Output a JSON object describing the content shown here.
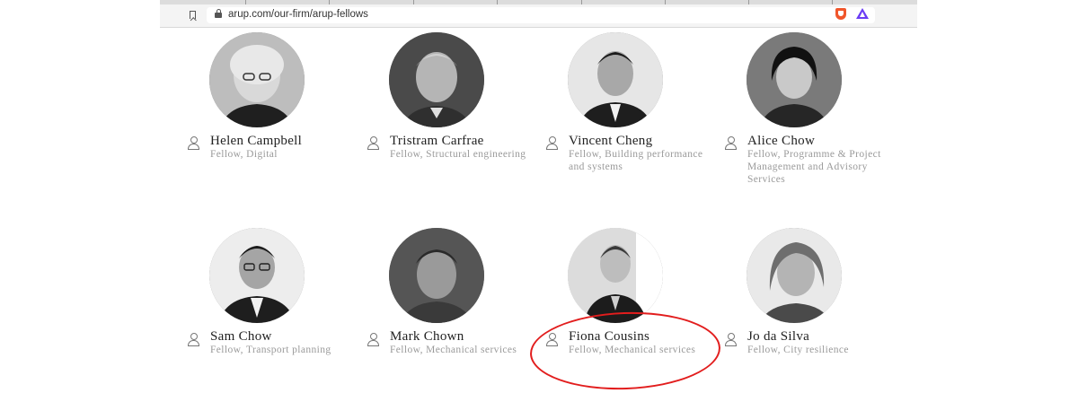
{
  "browser": {
    "url": "arup.com/our-firm/arup-fellows"
  },
  "fellows": [
    {
      "name": "Helen Campbell",
      "role": "Fellow, Digital"
    },
    {
      "name": "Tristram Carfrae",
      "role": "Fellow, Structural engineering"
    },
    {
      "name": "Vincent Cheng",
      "role": "Fellow, Building performance and systems"
    },
    {
      "name": "Alice Chow",
      "role": "Fellow, Programme & Project Management and Advisory Services"
    },
    {
      "name": "Sam Chow",
      "role": "Fellow, Transport planning"
    },
    {
      "name": "Mark Chown",
      "role": "Fellow, Mechanical services"
    },
    {
      "name": "Fiona Cousins",
      "role": "Fellow, Mechanical services"
    },
    {
      "name": "Jo da Silva",
      "role": "Fellow, City resilience"
    }
  ],
  "icons": {
    "bookmark": "bookmark-icon",
    "lock": "lock-icon",
    "brave": "brave-shields-icon",
    "rewards": "brave-rewards-icon",
    "person": "person-icon"
  },
  "colors": {
    "highlight": "#e21d1d",
    "name_text": "#222222",
    "role_text": "#9a9a9a"
  }
}
